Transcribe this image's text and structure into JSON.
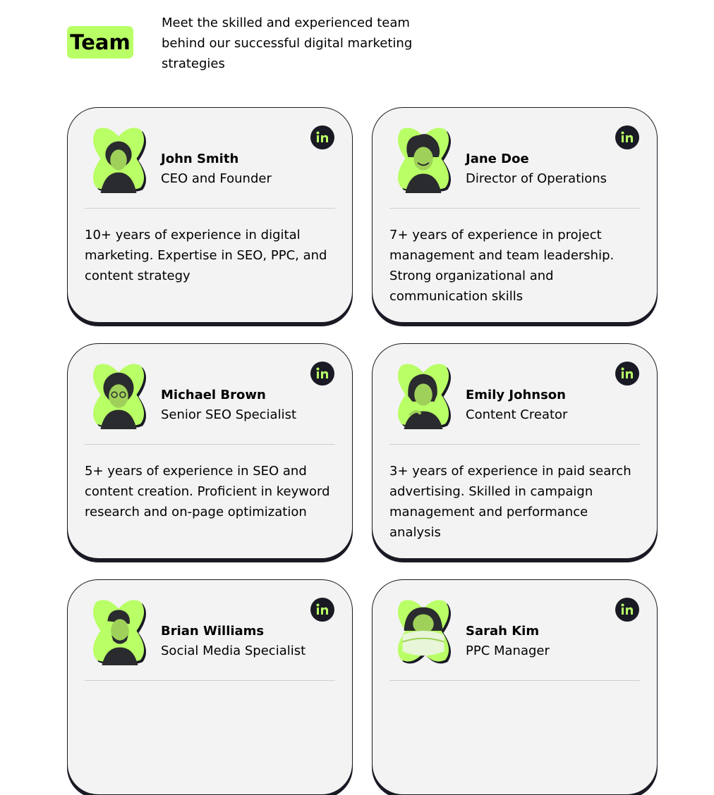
{
  "header": {
    "badge": "Team",
    "intro": "Meet the skilled and experienced team behind our successful digital marketing strategies"
  },
  "colors": {
    "accent": "#b9ff66",
    "dark": "#191a23",
    "card_bg": "#f3f3f3"
  },
  "team": [
    {
      "name": "John Smith",
      "role": "CEO and Founder",
      "bio": "10+ years of experience in digital marketing. Expertise in SEO, PPC, and content strategy",
      "icon": "linkedin-icon"
    },
    {
      "name": "Jane Doe",
      "role": "Director of Operations",
      "bio": "7+ years of experience in project management and team leadership. Strong organizational and communication skills",
      "icon": "linkedin-icon"
    },
    {
      "name": "Michael Brown",
      "role": "Senior SEO Specialist",
      "bio": "5+ years of experience in SEO and content creation. Proficient in keyword research and on-page optimization",
      "icon": "linkedin-icon"
    },
    {
      "name": "Emily Johnson",
      "role": "Content Creator",
      "bio": "3+ years of experience in paid search advertising. Skilled in campaign management and performance analysis",
      "icon": "linkedin-icon"
    },
    {
      "name": "Brian Williams",
      "role": "Social Media Specialist",
      "bio": "",
      "icon": "linkedin-icon"
    },
    {
      "name": "Sarah Kim",
      "role": "PPC Manager",
      "bio": "",
      "icon": "linkedin-icon"
    }
  ]
}
